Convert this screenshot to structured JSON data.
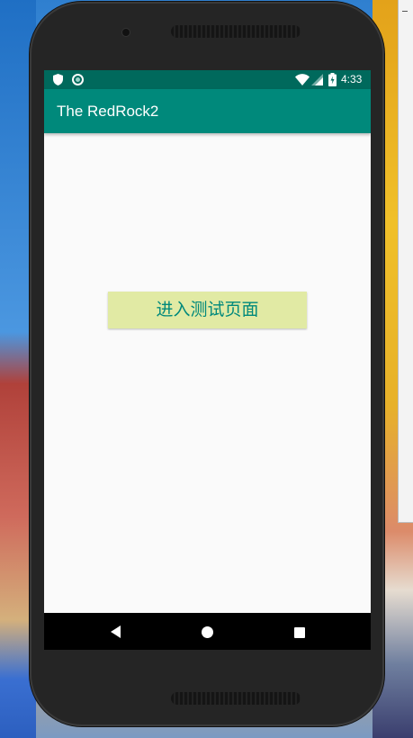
{
  "status_bar": {
    "time": "4:33",
    "icons": [
      "shield-icon",
      "circle-icon",
      "wifi-icon",
      "signal-icon",
      "battery-icon"
    ]
  },
  "app_bar": {
    "title": "The RedRock2"
  },
  "main": {
    "button_label": "进入测试页面"
  },
  "nav_bar": {
    "icons": [
      "back-icon",
      "home-icon",
      "recent-apps-icon"
    ]
  },
  "colors": {
    "status_bar": "#00695c",
    "app_bar": "#00897b",
    "button_bg": "#e1eaa4",
    "button_text": "#00897b",
    "screen_bg": "#fafafa"
  }
}
